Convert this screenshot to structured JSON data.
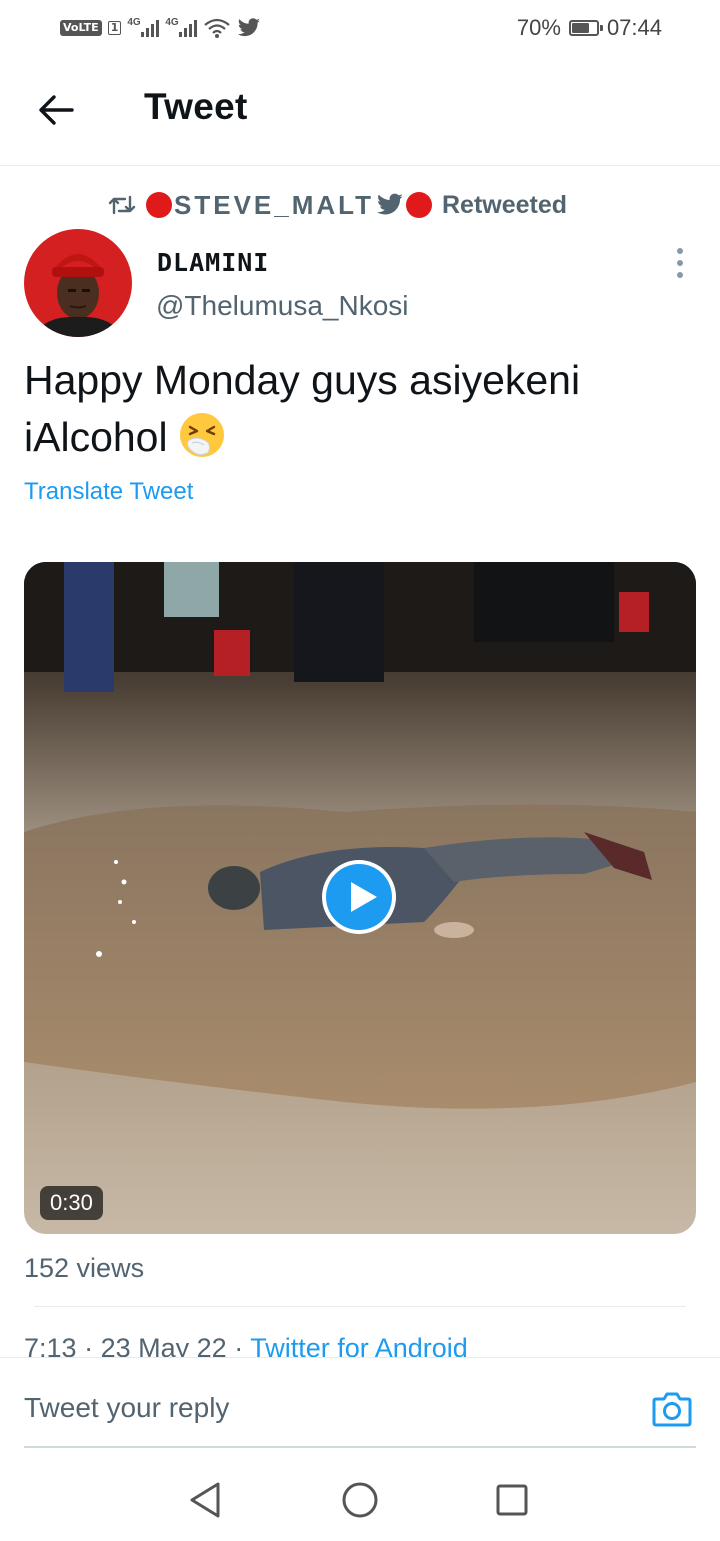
{
  "status_bar": {
    "volte": "VoLTE",
    "sim": "1",
    "net1": "4G",
    "net2": "4G",
    "battery_percent": "70%",
    "battery_level": 0.7,
    "time": "07:44"
  },
  "header": {
    "title": "Tweet"
  },
  "tweet": {
    "retweeter": "STEVE_MALT",
    "retweet_label": "Retweeted",
    "author_name": "DLAMINI",
    "author_handle": "@Thelumusa_Nkosi",
    "text": "Happy Monday guys asiyekeni iAlcohol",
    "translate_label": "Translate Tweet",
    "video_duration": "0:30",
    "views": "152 views",
    "time": "7:13",
    "sep": "·",
    "date": "23 May 22",
    "source": "Twitter for Android"
  },
  "reply": {
    "placeholder": "Tweet your reply"
  },
  "colors": {
    "link": "#1d9bf0",
    "secondary": "#536471",
    "red_dot": "#e0191b",
    "play": "#1d9bf0"
  },
  "icons": [
    "back-arrow-icon",
    "retweet-icon",
    "twitter-bird-icon",
    "more-vertical-icon",
    "sneezing-face-emoji",
    "play-icon",
    "camera-icon",
    "nav-back-icon",
    "nav-home-icon",
    "nav-recents-icon",
    "wifi-icon"
  ]
}
